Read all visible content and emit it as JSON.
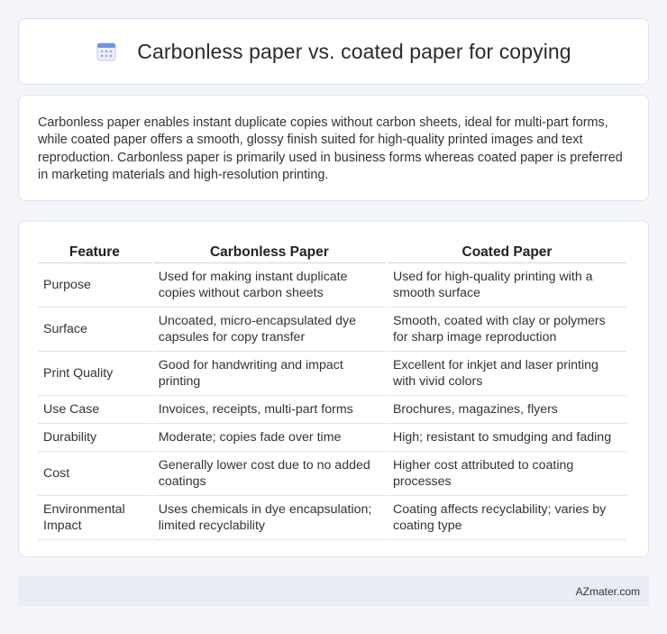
{
  "header": {
    "title": "Carbonless paper vs. coated paper for copying",
    "icon": "calendar-icon"
  },
  "intro": {
    "text": "Carbonless paper enables instant duplicate copies without carbon sheets, ideal for multi-part forms, while coated paper offers a smooth, glossy finish suited for high-quality printed images and text reproduction. Carbonless paper is primarily used in business forms whereas coated paper is preferred in marketing materials and high-resolution printing."
  },
  "table": {
    "headers": [
      "Feature",
      "Carbonless Paper",
      "Coated Paper"
    ],
    "rows": [
      [
        "Purpose",
        "Used for making instant duplicate copies without carbon sheets",
        "Used for high-quality printing with a smooth surface"
      ],
      [
        "Surface",
        "Uncoated, micro-encapsulated dye capsules for copy transfer",
        "Smooth, coated with clay or polymers for sharp image reproduction"
      ],
      [
        "Print Quality",
        "Good for handwriting and impact printing",
        "Excellent for inkjet and laser printing with vivid colors"
      ],
      [
        "Use Case",
        "Invoices, receipts, multi-part forms",
        "Brochures, magazines, flyers"
      ],
      [
        "Durability",
        "Moderate; copies fade over time",
        "High; resistant to smudging and fading"
      ],
      [
        "Cost",
        "Generally lower cost due to no added coatings",
        "Higher cost attributed to coating processes"
      ],
      [
        "Environmental Impact",
        "Uses chemicals in dye encapsulation; limited recyclability",
        "Coating affects recyclability; varies by coating type"
      ]
    ]
  },
  "footer": {
    "text": "AZmater.com"
  },
  "colors": {
    "background": "#f3f5fa",
    "card": "#ffffff",
    "footer": "#e8ecf5",
    "icon_blue": "#5b8def",
    "icon_pink": "#e8a0c8"
  }
}
